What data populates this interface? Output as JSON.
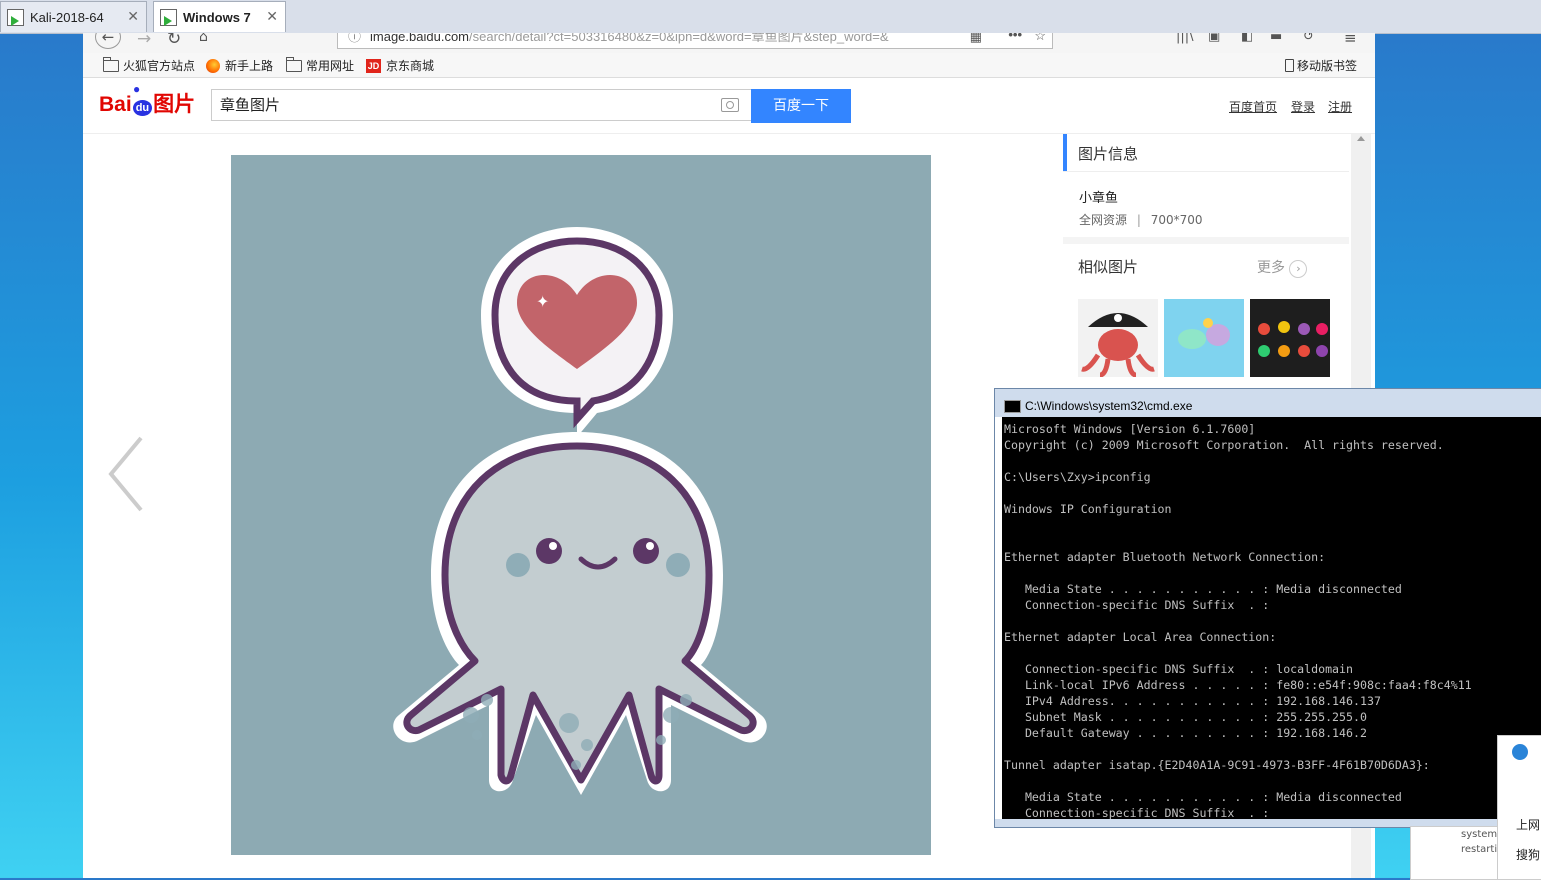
{
  "vm_tabs": [
    {
      "label": "Kali-2018-64"
    },
    {
      "label": "Windows 7"
    }
  ],
  "browser": {
    "url_host": "image.baidu.com",
    "url_path": "/search/detail?ct=503316480&z=0&ipn=d&word=章鱼图片&step_word=&",
    "bookmarks": [
      "火狐官方站点",
      "新手上路",
      "常用网址",
      "京东商城"
    ],
    "mobile_bookmarks": "移动版书签"
  },
  "baidu": {
    "logo_text": "Bai",
    "logo_du": "du",
    "logo_suffix": "图片",
    "query": "章鱼图片",
    "search_button": "百度一下",
    "links": [
      "百度首页",
      "登录",
      "注册"
    ]
  },
  "sidebar": {
    "info_title": "图片信息",
    "image_name": "小章鱼",
    "source": "全网资源",
    "size": "700*700",
    "similar_title": "相似图片",
    "more": "更多"
  },
  "cmd": {
    "title": "C:\\Windows\\system32\\cmd.exe",
    "lines": [
      "Microsoft Windows [Version 6.1.7600]",
      "Copyright (c) 2009 Microsoft Corporation.  All rights reserved.",
      "",
      "C:\\Users\\Zxy>ipconfig",
      "",
      "Windows IP Configuration",
      "",
      "",
      "Ethernet adapter Bluetooth Network Connection:",
      "",
      "   Media State . . . . . . . . . . . : Media disconnected",
      "   Connection-specific DNS Suffix  . :",
      "",
      "Ethernet adapter Local Area Connection:",
      "",
      "   Connection-specific DNS Suffix  . : localdomain",
      "   Link-local IPv6 Address . . . . . : fe80::e54f:908c:faa4:f8c4%11",
      "   IPv4 Address. . . . . . . . . . . : 192.168.146.137",
      "   Subnet Mask . . . . . . . . . . . : 255.255.255.0",
      "   Default Gateway . . . . . . . . . : 192.168.146.2",
      "",
      "Tunnel adapter isatap.{E2D40A1A-9C91-4973-B3FF-4F61B70D6DA3}:",
      "",
      "   Media State . . . . . . . . . . . : Media disconnected",
      "   Connection-specific DNS Suffix  . :"
    ]
  },
  "popup": {
    "text1": "上网",
    "text2": "搜狗",
    "text3": "system",
    "text4": "restarti"
  }
}
